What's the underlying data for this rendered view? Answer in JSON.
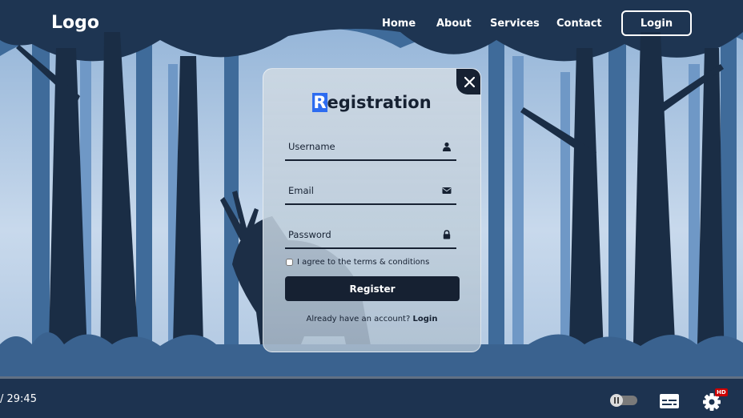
{
  "nav": {
    "logo": "Logo",
    "links": [
      "Home",
      "About",
      "Services",
      "Contact"
    ],
    "login_button": "Login"
  },
  "form": {
    "title_first_letter": "R",
    "title_rest": "egistration",
    "close_icon": "close-icon",
    "username_placeholder": "Username",
    "username_icon": "user-icon",
    "email_placeholder": "Email",
    "email_icon": "mail-icon",
    "password_placeholder": "Password",
    "password_icon": "lock-icon",
    "agree_label": "I agree to the terms & conditions",
    "agree_checked": false,
    "register_button": "Register",
    "already_text": "Already have an account?",
    "login_link": "Login"
  },
  "player": {
    "time": "/ 29:45",
    "hd_badge": "HD",
    "icons": [
      "autoplay-toggle-icon",
      "subtitles-icon",
      "settings-gear-icon"
    ]
  },
  "colors": {
    "navy": "#162132",
    "highlight": "#2d6cf0",
    "badge_red": "#cc0000",
    "sky": "#bcd0e6"
  }
}
